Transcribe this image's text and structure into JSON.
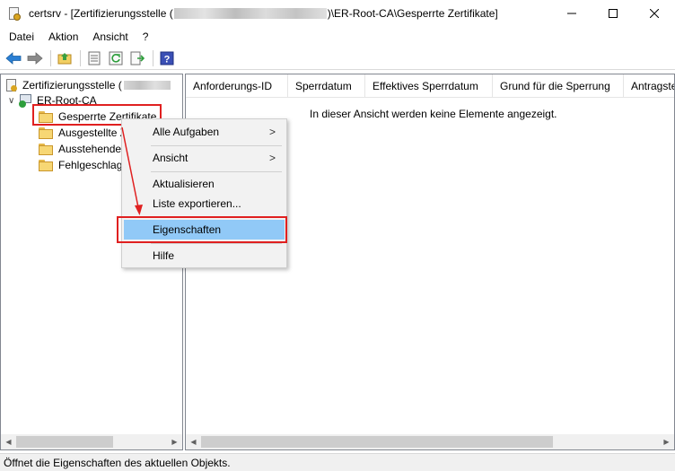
{
  "window": {
    "title_prefix": "certsrv - [Zertifizierungsstelle (",
    "title_suffix": ")\\ER-Root-CA\\Gesperrte Zertifikate]"
  },
  "menu": [
    "Datei",
    "Aktion",
    "Ansicht",
    "?"
  ],
  "toolbar": {
    "buttons": [
      "back-arrow-icon",
      "forward-arrow-icon",
      "up-folder-icon",
      "properties-icon",
      "refresh-icon",
      "export-list-icon",
      "help-icon"
    ]
  },
  "tree": {
    "root_label": "Zertifizierungsstelle (",
    "ca_label": "ER-Root-CA",
    "items": [
      "Gesperrte Zertifikate",
      "Ausgestellte Z",
      "Ausstehende",
      "Fehlgeschlag"
    ]
  },
  "list": {
    "columns": [
      "Anforderungs-ID",
      "Sperrdatum",
      "Effektives Sperrdatum",
      "Grund für die Sperrung",
      "Antragste"
    ],
    "empty_message": "In dieser Ansicht werden keine Elemente angezeigt."
  },
  "context_menu": {
    "items": [
      "Alle Aufgaben",
      "Ansicht",
      "Aktualisieren",
      "Liste exportieren...",
      "Eigenschaften",
      "Hilfe"
    ],
    "submenu_arrow": ">",
    "selected": "Eigenschaften"
  },
  "status_text": "Öffnet die Eigenschaften des aktuellen Objekts.",
  "colors": {
    "highlight_border": "#e02020",
    "selected_item": "#91c9f7"
  }
}
